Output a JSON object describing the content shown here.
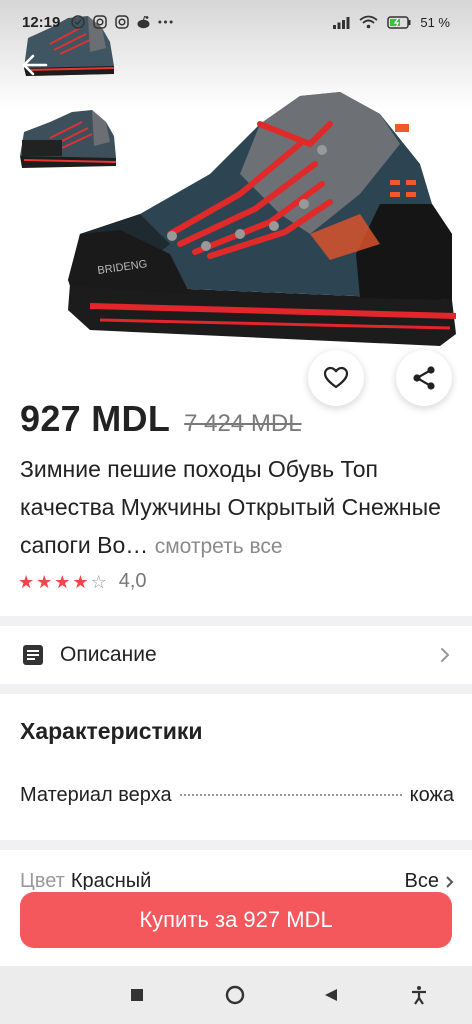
{
  "status_bar": {
    "time": "12:19",
    "battery": "51 %",
    "icons": [
      "check-circle-icon",
      "instagram-icon",
      "instagram-icon",
      "reddit-icon",
      "more-dots-icon"
    ]
  },
  "product": {
    "price": "927 MDL",
    "old_price": "7 424 MDL",
    "title": "Зимние пешие походы Обувь Топ качества Мужчины Открытый Снежные сапоги Во…",
    "see_all": "смотреть все",
    "rating": {
      "stars": 4,
      "max": 5,
      "value": "4,0"
    }
  },
  "description": {
    "label": "Описание"
  },
  "characteristics": {
    "title": "Характеристики",
    "rows": [
      {
        "name": "Материал верха",
        "value": "кожа"
      }
    ]
  },
  "color": {
    "label": "Цвет",
    "value": "Красный",
    "all_label": "Все"
  },
  "buy": {
    "label": "Купить за 927 MDL"
  },
  "colors": {
    "accent": "#f4575c",
    "star": "#f2454c"
  }
}
